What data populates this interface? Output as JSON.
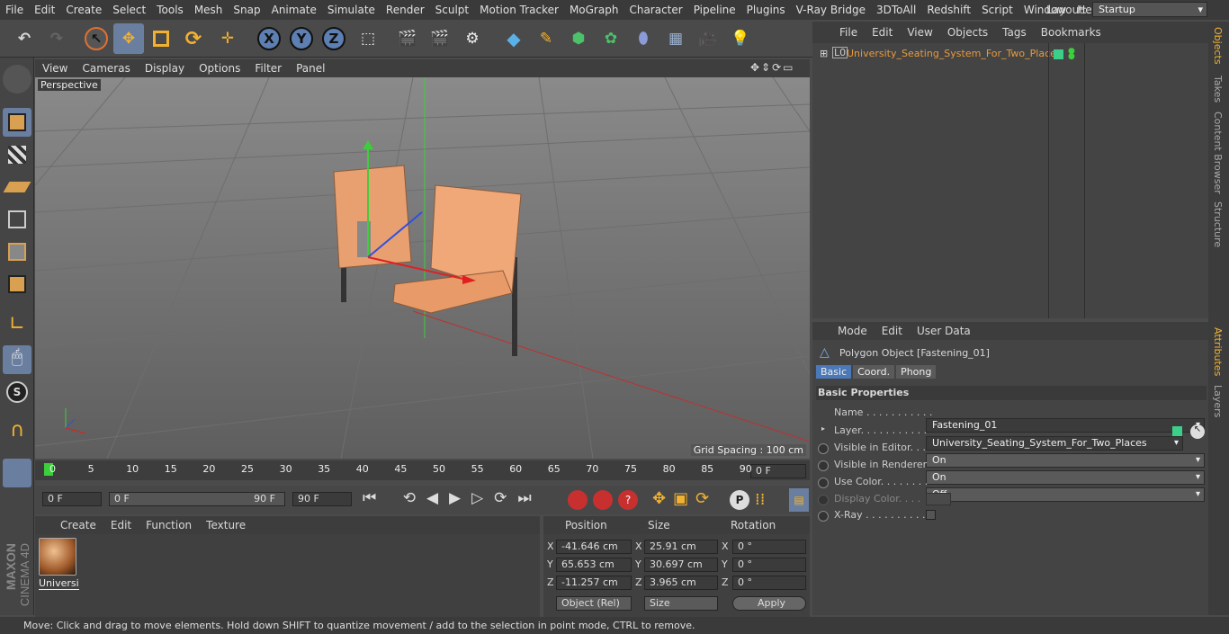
{
  "menu": [
    "File",
    "Edit",
    "Create",
    "Select",
    "Tools",
    "Mesh",
    "Snap",
    "Animate",
    "Simulate",
    "Render",
    "Sculpt",
    "Motion Tracker",
    "MoGraph",
    "Character",
    "Pipeline",
    "Plugins",
    "V-Ray Bridge",
    "3DToAll",
    "Redshift",
    "Script",
    "Window",
    "Help"
  ],
  "layout": {
    "label": "Layout:",
    "value": "Startup"
  },
  "toolbar": {
    "x": "X",
    "y": "Y",
    "z": "Z",
    "p": "P",
    "s": "S"
  },
  "viewport": {
    "menu": [
      "View",
      "Cameras",
      "Display",
      "Options",
      "Filter",
      "Panel"
    ],
    "label": "Perspective",
    "grid": "Grid Spacing : 100 cm"
  },
  "timeline": {
    "ticks": [
      "0",
      "5",
      "10",
      "15",
      "20",
      "25",
      "30",
      "35",
      "40",
      "45",
      "50",
      "55",
      "60",
      "65",
      "70",
      "75",
      "80",
      "85",
      "90"
    ],
    "end": "0 F"
  },
  "transport": {
    "start": "0 F",
    "range_a": "0 F",
    "range_b": "90 F",
    "end": "90 F"
  },
  "material": {
    "menu": [
      "Create",
      "Edit",
      "Function",
      "Texture"
    ],
    "name": "Universi"
  },
  "coords": {
    "headers": [
      "Position",
      "Size",
      "Rotation"
    ],
    "rows": [
      {
        "axis": "X",
        "pos": "-41.646 cm",
        "size": "25.91 cm",
        "rot": "0 °"
      },
      {
        "axis": "Y",
        "pos": "65.653 cm",
        "size": "30.697 cm",
        "rot": "0 °"
      },
      {
        "axis": "Z",
        "pos": "-11.257 cm",
        "size": "3.965 cm",
        "rot": "0 °"
      }
    ],
    "mode": "Object (Rel)",
    "size_mode": "Size",
    "apply": "Apply"
  },
  "objects": {
    "menu": [
      "File",
      "Edit",
      "View",
      "Objects",
      "Tags",
      "Bookmarks"
    ],
    "item": "University_Seating_System_For_Two_Places",
    "item_color": "#e89a3c"
  },
  "attributes": {
    "menu": [
      "Mode",
      "Edit",
      "User Data"
    ],
    "title": "Polygon Object [Fastening_01]",
    "tabs": [
      "Basic",
      "Coord.",
      "Phong"
    ],
    "section": "Basic Properties",
    "name_label": "Name . . . . . . . . . . .",
    "name_value": "Fastening_01",
    "layer_label": "Layer. . . . . . . . . . .",
    "layer_value": "University_Seating_System_For_Two_Places",
    "visible_editor_label": "Visible in Editor. . .",
    "visible_editor": "On",
    "visible_renderer_label": "Visible in Renderer",
    "visible_renderer": "On",
    "use_color_label": "Use Color. . . . . . . .",
    "use_color": "Off",
    "display_color_label": "Display Color. . . .",
    "xray_label": "X-Ray . . . . . . . . . ."
  },
  "sidetabs": [
    "Objects",
    "Takes",
    "Content Browser",
    "Structure",
    "Attributes",
    "Layers"
  ],
  "brand": {
    "maxon": "MAXON",
    "cinema": "CINEMA 4D"
  },
  "status": "Move: Click and drag to move elements. Hold down SHIFT to quantize movement / add to the selection in point mode, CTRL to remove."
}
